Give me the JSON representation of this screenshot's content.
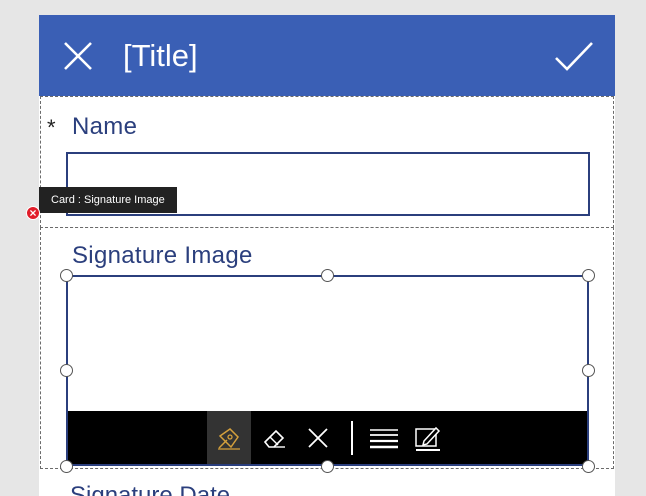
{
  "header": {
    "title": "[Title]",
    "close_icon": "close-icon",
    "submit_icon": "checkmark-icon",
    "background": "#3a5fb5"
  },
  "form": {
    "name_field": {
      "required_marker": "*",
      "label": "Name",
      "value": "",
      "placeholder": ""
    },
    "signature_card": {
      "tooltip": "Card : Signature Image",
      "error_icon": "error-badge-icon",
      "label": "Signature Image",
      "toolbar": [
        "pen-icon",
        "eraser-icon",
        "clear-icon",
        "line-thickness-icon",
        "pen-color-icon"
      ]
    },
    "date_field": {
      "label": "Signature Date"
    }
  },
  "colors": {
    "accent": "#3a5fb5",
    "label": "#2b3f7d",
    "error": "#e11d2a",
    "pen_active": "#d4a03c"
  }
}
